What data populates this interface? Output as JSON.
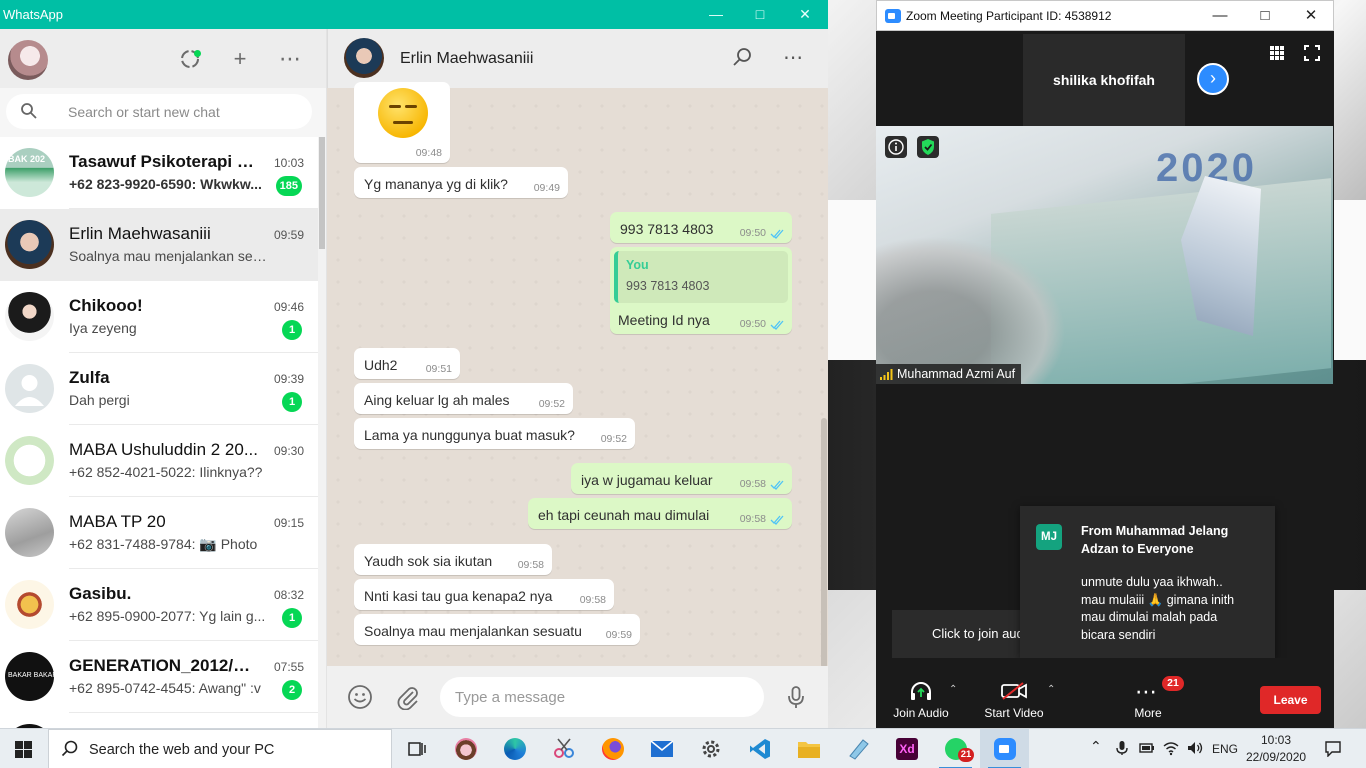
{
  "whatsapp": {
    "title": "WhatsApp",
    "search_placeholder": "Search or start new chat",
    "chats": [
      {
        "name": "Tasawuf Psikoterapi 20...",
        "time": "10:03",
        "preview": "+62 823-9920-6590: Wkwkw...",
        "badge": "185",
        "bold": true,
        "avatar_text": "BAK 202"
      },
      {
        "name": "Erlin Maehwasaniii",
        "time": "09:59",
        "preview": "Soalnya mau menjalankan sesuatu",
        "badge": "",
        "bold": false
      },
      {
        "name": "Chikooo!",
        "time": "09:46",
        "preview": "Iya zeyeng",
        "badge": "1",
        "bold": true
      },
      {
        "name": "Zulfa",
        "time": "09:39",
        "preview": "Dah pergi",
        "badge": "1",
        "bold": true
      },
      {
        "name": "MABA Ushuluddin 2 20...",
        "time": "09:30",
        "preview": "+62 852-4021-5022: Ilinknya??",
        "badge": "",
        "bold": false
      },
      {
        "name": "MABA TP 20",
        "time": "09:15",
        "preview": "+62 831-7488-9784: 📷 Photo",
        "badge": "",
        "bold": false
      },
      {
        "name": "Gasibu.",
        "time": "08:32",
        "preview": "+62 895-0900-2077: Yg lain g...",
        "badge": "1",
        "bold": true
      },
      {
        "name": "GENERATION_2012/20...",
        "time": "07:55",
        "preview": "+62 895-0742-4545: Awang\" :v",
        "badge": "2",
        "bold": true,
        "avatar_text": "BAKAR BAKAR"
      }
    ],
    "contact_name": "Erlin Maehwasaniii",
    "messages": [
      {
        "dir": "in",
        "kind": "emoji",
        "time": "09:48"
      },
      {
        "dir": "in",
        "text": "Yg mananya yg di klik?",
        "time": "09:49"
      },
      {
        "dir": "out",
        "text": "993 7813 4803",
        "time": "09:50"
      },
      {
        "dir": "out",
        "quote_author": "You",
        "quote_text": "993 7813 4803",
        "text": "Meeting Id nya",
        "time": "09:50"
      },
      {
        "dir": "in",
        "text": "Udh2",
        "time": "09:51"
      },
      {
        "dir": "in",
        "text": "Aing keluar lg ah males",
        "time": "09:52"
      },
      {
        "dir": "in",
        "text": "Lama ya nunggunya buat masuk?",
        "time": "09:52"
      },
      {
        "dir": "out",
        "text": "iya w jugamau keluar",
        "time": "09:58"
      },
      {
        "dir": "out",
        "text": "eh tapi ceunah mau dimulai",
        "time": "09:58"
      },
      {
        "dir": "in",
        "text": "Yaudh sok sia ikutan",
        "time": "09:58"
      },
      {
        "dir": "in",
        "text": "Nnti kasi tau gua kenapa2 nya",
        "time": "09:58"
      },
      {
        "dir": "in",
        "text": "Soalnya mau menjalankan sesuatu",
        "time": "09:59"
      }
    ],
    "message_placeholder": "Type a message",
    "colors": {
      "teal": "#00bfa5",
      "unread_green": "#06d755",
      "outgoing_bubble": "#dcf8c6",
      "chat_bg": "#e5ddd5"
    }
  },
  "zoom": {
    "title": "Zoom Meeting Participant ID: 4538912",
    "active_speaker": "shilika khofifah",
    "video_name": "Muhammad Azmi Auf",
    "video_text": "2020",
    "join_tip": "Click to join audio",
    "chat_popup": {
      "initials": "MJ",
      "from": "From Muhammad Jelang Adzan to Everyone",
      "body": "unmute dulu yaa ikhwah..\nmau mulaiii 🙏 gimana inith\nmau dimulai malah pada\nbicara sendiri"
    },
    "toolbar": {
      "join_audio": "Join Audio",
      "start_video": "Start Video",
      "more": "More",
      "more_badge": "21",
      "leave": "Leave"
    },
    "colors": {
      "blue": "#2d8cff",
      "red": "#e02828"
    }
  },
  "taskbar": {
    "search_placeholder": "Search the web and your PC",
    "apps": [
      "task-view",
      "bear-app",
      "edge",
      "snipping-tool",
      "firefox",
      "mail",
      "settings",
      "vscode",
      "file-explorer",
      "notes",
      "adobe-xd",
      "whatsapp",
      "zoom"
    ],
    "adobe_xd_label": "Xd",
    "whatsapp_badge": "21",
    "language": "ENG",
    "time": "10:03",
    "date": "22/09/2020"
  }
}
